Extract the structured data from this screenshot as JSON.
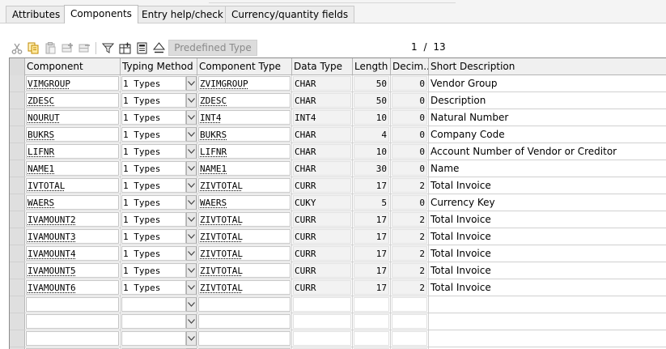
{
  "tabs": [
    "Attributes",
    "Components",
    "Entry help/check",
    "Currency/quantity fields"
  ],
  "active_tab": "Components",
  "toolbar": {
    "predefined_type_label": "Predefined Type",
    "page_current": "1",
    "page_separator": "/",
    "page_total": "13",
    "icons": [
      "cut-icon",
      "copy-icon",
      "paste-icon",
      "insert-row-icon",
      "delete-row-icon",
      "filter-icon",
      "insert-table-icon",
      "details-icon",
      "sort-icon"
    ]
  },
  "columns": [
    "Component",
    "Typing Method",
    "Component Type",
    "Data Type",
    "Length",
    "Decim...",
    "Short Description"
  ],
  "rows": [
    {
      "component": "VIMGROUP",
      "typing": "1 Types",
      "ctype": "ZVIMGROUP",
      "dtype": "CHAR",
      "length": "50",
      "decimals": "0",
      "desc": "Vendor Group"
    },
    {
      "component": "ZDESC",
      "typing": "1 Types",
      "ctype": "ZDESC",
      "dtype": "CHAR",
      "length": "50",
      "decimals": "0",
      "desc": "Description"
    },
    {
      "component": "NOURUT",
      "typing": "1 Types",
      "ctype": "INT4",
      "dtype": "INT4",
      "length": "10",
      "decimals": "0",
      "desc": "Natural Number"
    },
    {
      "component": "BUKRS",
      "typing": "1 Types",
      "ctype": "BUKRS",
      "dtype": "CHAR",
      "length": "4",
      "decimals": "0",
      "desc": "Company Code"
    },
    {
      "component": "LIFNR",
      "typing": "1 Types",
      "ctype": "LIFNR",
      "dtype": "CHAR",
      "length": "10",
      "decimals": "0",
      "desc": "Account Number of Vendor or Creditor"
    },
    {
      "component": "NAME1",
      "typing": "1 Types",
      "ctype": "NAME1",
      "dtype": "CHAR",
      "length": "30",
      "decimals": "0",
      "desc": "Name"
    },
    {
      "component": "IVTOTAL",
      "typing": "1 Types",
      "ctype": "ZIVTOTAL",
      "dtype": "CURR",
      "length": "17",
      "decimals": "2",
      "desc": "Total Invoice"
    },
    {
      "component": "WAERS",
      "typing": "1 Types",
      "ctype": "WAERS",
      "dtype": "CUKY",
      "length": "5",
      "decimals": "0",
      "desc": "Currency Key"
    },
    {
      "component": "IVAMOUNT2",
      "typing": "1 Types",
      "ctype": "ZIVTOTAL",
      "dtype": "CURR",
      "length": "17",
      "decimals": "2",
      "desc": "Total Invoice"
    },
    {
      "component": "IVAMOUNT3",
      "typing": "1 Types",
      "ctype": "ZIVTOTAL",
      "dtype": "CURR",
      "length": "17",
      "decimals": "2",
      "desc": "Total Invoice"
    },
    {
      "component": "IVAMOUNT4",
      "typing": "1 Types",
      "ctype": "ZIVTOTAL",
      "dtype": "CURR",
      "length": "17",
      "decimals": "2",
      "desc": "Total Invoice"
    },
    {
      "component": "IVAMOUNT5",
      "typing": "1 Types",
      "ctype": "ZIVTOTAL",
      "dtype": "CURR",
      "length": "17",
      "decimals": "2",
      "desc": "Total Invoice"
    },
    {
      "component": "IVAMOUNT6",
      "typing": "1 Types",
      "ctype": "ZIVTOTAL",
      "dtype": "CURR",
      "length": "17",
      "decimals": "2",
      "desc": "Total Invoice"
    },
    {
      "component": "",
      "typing": "",
      "ctype": "",
      "dtype": "",
      "length": "",
      "decimals": "",
      "desc": ""
    },
    {
      "component": "",
      "typing": "",
      "ctype": "",
      "dtype": "",
      "length": "",
      "decimals": "",
      "desc": ""
    },
    {
      "component": "",
      "typing": "",
      "ctype": "",
      "dtype": "",
      "length": "",
      "decimals": "",
      "desc": ""
    },
    {
      "component": "",
      "typing": "",
      "ctype": "",
      "dtype": "",
      "length": "",
      "decimals": "",
      "desc": ""
    }
  ]
}
